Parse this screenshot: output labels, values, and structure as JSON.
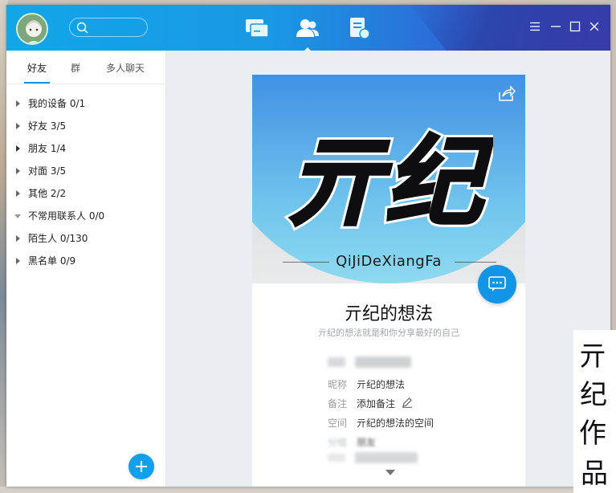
{
  "header": {
    "search_placeholder": "",
    "main_tabs": [
      {
        "name": "messages",
        "icon": "chat-window-icon"
      },
      {
        "name": "contacts",
        "icon": "contacts-icon",
        "active": true
      },
      {
        "name": "space",
        "icon": "notes-icon"
      }
    ]
  },
  "sidebar": {
    "tabs": [
      {
        "label": "好友",
        "active": true
      },
      {
        "label": "群"
      },
      {
        "label": "多人聊天"
      }
    ],
    "groups": [
      {
        "label": "我的设备",
        "count": "0/1",
        "expanded": false
      },
      {
        "label": "好友",
        "count": "3/5",
        "expanded": false
      },
      {
        "label": "朋友",
        "count": "1/4",
        "expanded": false
      },
      {
        "label": "对面",
        "count": "3/5",
        "expanded": false
      },
      {
        "label": "其他",
        "count": "2/2",
        "expanded": false
      },
      {
        "label": "不常用联系人",
        "count": "0/0",
        "expanded": true
      },
      {
        "label": "陌生人",
        "count": "0/130",
        "expanded": false
      },
      {
        "label": "黑名单",
        "count": "0/9",
        "expanded": false
      }
    ]
  },
  "profile": {
    "banner_logo_text": "亓纪",
    "banner_text": "QiJiDeXiangFa",
    "name": "亓纪的想法",
    "signature": "亓纪的想法就是和你分享最好的自己",
    "fields": [
      {
        "label": "昵称",
        "value": "亓纪的想法"
      },
      {
        "label": "备注",
        "value": "添加备注"
      },
      {
        "label": "空间",
        "value": "亓纪的想法的空间"
      },
      {
        "label": "分组",
        "value": "朋友"
      }
    ]
  },
  "watermark": {
    "chars": [
      "亓",
      "纪",
      "作",
      "品"
    ]
  },
  "colors": {
    "titlebar": "#13a2e8",
    "accent": "#1296db",
    "sidebar_bg": "#ffffff",
    "content_bg": "#eaedf1"
  }
}
